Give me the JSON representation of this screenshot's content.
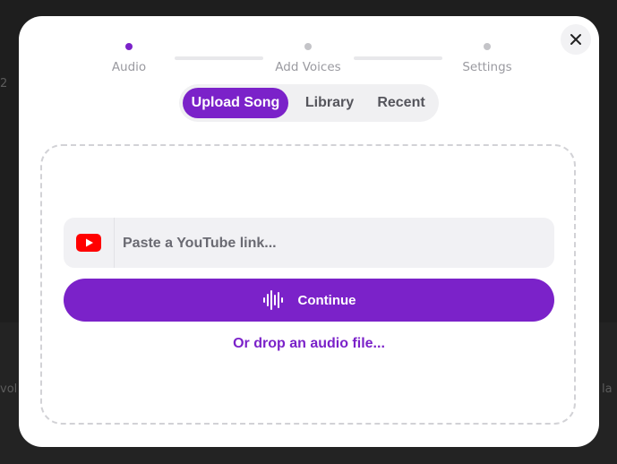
{
  "steps": [
    {
      "label": "Audio",
      "active": true
    },
    {
      "label": "Add Voices",
      "active": false
    },
    {
      "label": "Settings",
      "active": false
    }
  ],
  "tabs": [
    {
      "label": "Upload Song",
      "active": true
    },
    {
      "label": "Library",
      "active": false
    },
    {
      "label": "Recent",
      "active": false
    }
  ],
  "upload": {
    "youtube_placeholder": "Paste a YouTube link...",
    "continue_label": "Continue",
    "drop_link": "Or drop an audio file..."
  },
  "background": {
    "fragments": [
      "2",
      "vol",
      "la"
    ]
  },
  "colors": {
    "accent": "#7b22c9",
    "youtube_red": "#ff0000"
  },
  "icons": {
    "close": "close-icon",
    "youtube": "youtube-icon",
    "waveform": "waveform-icon"
  }
}
